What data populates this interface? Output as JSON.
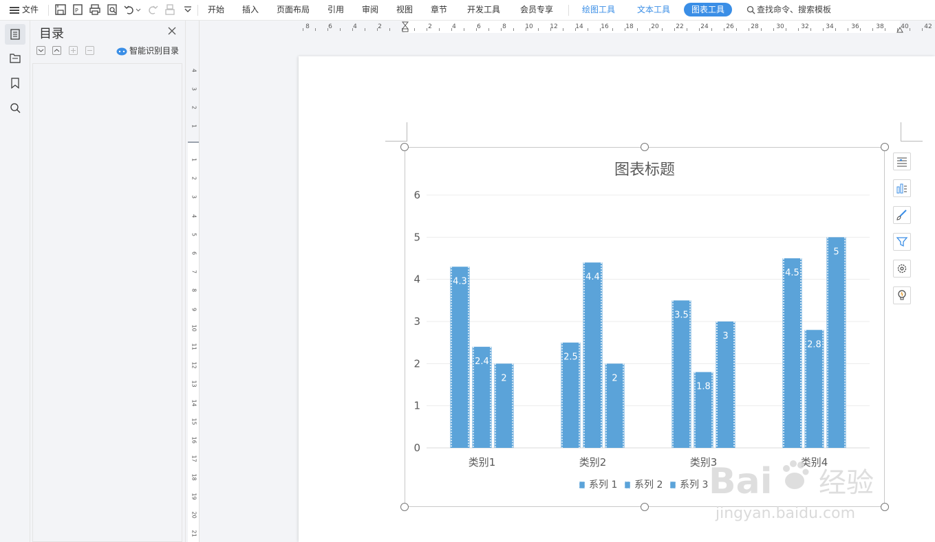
{
  "toolbar": {
    "file_label": "文件",
    "tabs": [
      {
        "label": "开始"
      },
      {
        "label": "插入"
      },
      {
        "label": "页面布局"
      },
      {
        "label": "引用"
      },
      {
        "label": "审阅"
      },
      {
        "label": "视图"
      },
      {
        "label": "章节"
      },
      {
        "label": "开发工具"
      },
      {
        "label": "会员专享"
      }
    ],
    "context_tabs": [
      {
        "label": "绘图工具"
      },
      {
        "label": "文本工具"
      },
      {
        "label": "图表工具"
      }
    ],
    "search_placeholder": "查找命令、搜索模板",
    "accent_color": "#3a8ee6"
  },
  "toc_panel": {
    "title": "目录",
    "smart_label": "智能识别目录"
  },
  "rulers": {
    "horizontal_labels": [
      "8",
      "6",
      "4",
      "2",
      "2",
      "4",
      "6",
      "8",
      "10",
      "12",
      "14",
      "16",
      "18",
      "20",
      "22",
      "24",
      "26",
      "28",
      "30",
      "32",
      "34",
      "36",
      "38",
      "40",
      "42"
    ],
    "vertical_top_labels": [
      "4",
      "3",
      "2",
      "1"
    ],
    "vertical_labels": [
      "1",
      "2",
      "3",
      "4",
      "5",
      "6",
      "7",
      "8",
      "9",
      "10",
      "11",
      "12",
      "13",
      "14",
      "15",
      "16",
      "17",
      "18",
      "19",
      "20",
      "21"
    ]
  },
  "chart_data": {
    "type": "bar",
    "title": "图表标题",
    "categories": [
      "类别1",
      "类别2",
      "类别3",
      "类别4"
    ],
    "series": [
      {
        "name": "系列 1",
        "values": [
          4.3,
          2.5,
          3.5,
          4.5
        ]
      },
      {
        "name": "系列 2",
        "values": [
          2.4,
          4.4,
          1.8,
          2.8
        ]
      },
      {
        "name": "系列 3",
        "values": [
          2,
          2,
          3,
          5
        ]
      }
    ],
    "ylim": [
      0,
      6
    ],
    "yticks": [
      "0",
      "1",
      "2",
      "3",
      "4",
      "5",
      "6"
    ],
    "data_labels": true,
    "bar_color": "#5ba3d9",
    "grid": true,
    "legend": "bottom"
  },
  "chart_side_buttons": [
    {
      "icon": "chart-elements-icon"
    },
    {
      "icon": "chart-style-icon"
    },
    {
      "icon": "brush-icon"
    },
    {
      "icon": "filter-icon"
    },
    {
      "icon": "settings-icon"
    },
    {
      "icon": "lightbulb-icon"
    }
  ],
  "watermark": {
    "brand": "Bai",
    "brand_cn": "经验",
    "url": "jingyan.baidu.com"
  }
}
